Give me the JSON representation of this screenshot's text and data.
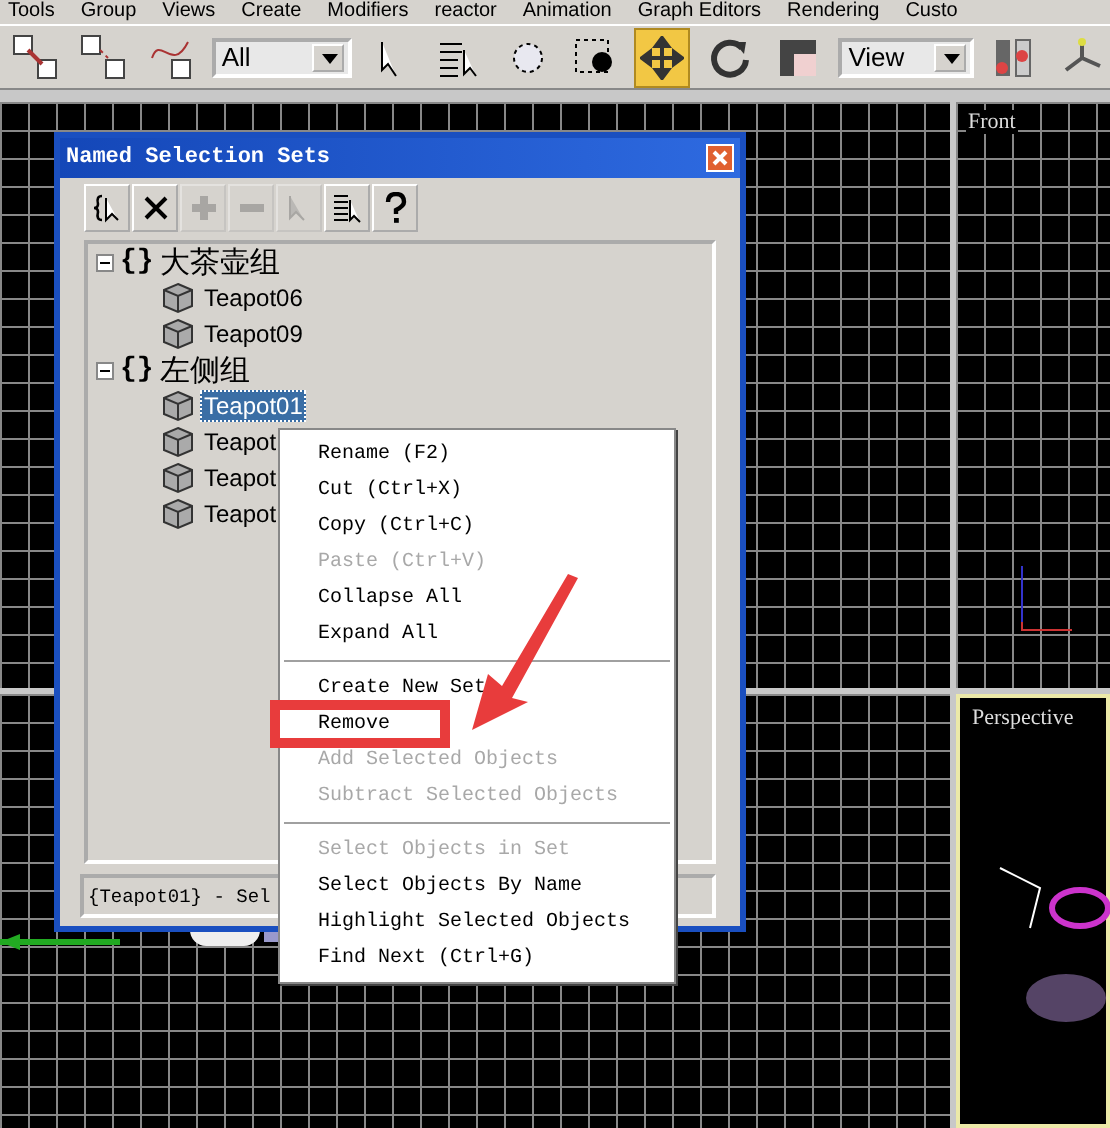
{
  "menu_bar": [
    "Tools",
    "Group",
    "Views",
    "Create",
    "Modifiers",
    "reactor",
    "Animation",
    "Graph Editors",
    "Rendering",
    "Custo"
  ],
  "toolbar": {
    "selection_filter": "All",
    "coordinate_system": "View",
    "move_active": true
  },
  "viewports": [
    {
      "selected": false
    },
    {
      "label": "Front",
      "selected": false
    },
    {
      "selected": false
    },
    {
      "label": "Perspective",
      "selected": true
    }
  ],
  "dialog": {
    "title": "Named Selection Sets",
    "tools": [
      {
        "disabled": false
      },
      {
        "disabled": false
      },
      {
        "disabled": true
      },
      {
        "disabled": true
      },
      {
        "disabled": true
      },
      {
        "disabled": false
      },
      {
        "disabled": false
      }
    ],
    "tree": [
      {
        "label": "{}",
        "name": "大茶壶组",
        "expanded": true,
        "children": [
          {
            "label": "Teapot06",
            "selected": false
          },
          {
            "label": "Teapot09",
            "selected": false
          }
        ]
      },
      {
        "label": "{}",
        "name": "左侧组",
        "expanded": true,
        "children": [
          {
            "label": "Teapot01",
            "selected": true
          },
          {
            "label": "Teapot",
            "selected": false
          },
          {
            "label": "Teapot",
            "selected": false
          },
          {
            "label": "Teapot",
            "selected": false
          }
        ]
      }
    ],
    "status": "{Teapot01} - Sel"
  },
  "context_menu": [
    {
      "kind": "item",
      "label": "Rename (F2)",
      "disabled": false
    },
    {
      "kind": "item",
      "label": "Cut (Ctrl+X)",
      "disabled": false
    },
    {
      "kind": "item",
      "label": "Copy (Ctrl+C)",
      "disabled": false
    },
    {
      "kind": "item",
      "label": "Paste (Ctrl+V)",
      "disabled": true
    },
    {
      "kind": "item",
      "label": "Collapse All",
      "disabled": false
    },
    {
      "kind": "item",
      "label": "Expand All",
      "disabled": false
    },
    {
      "kind": "separator"
    },
    {
      "kind": "item",
      "label": "Create New Set",
      "disabled": false
    },
    {
      "kind": "item",
      "label": "Remove",
      "disabled": false,
      "highlighted": true
    },
    {
      "kind": "item",
      "label": "Add Selected Objects",
      "disabled": true
    },
    {
      "kind": "item",
      "label": "Subtract Selected Objects",
      "disabled": true
    },
    {
      "kind": "separator"
    },
    {
      "kind": "item",
      "label": "Select Objects in Set",
      "disabled": true
    },
    {
      "kind": "item",
      "label": "Select Objects By Name",
      "disabled": false
    },
    {
      "kind": "item",
      "label": "Highlight Selected Objects",
      "disabled": false
    },
    {
      "kind": "item",
      "label": "Find Next (Ctrl+G)",
      "disabled": false
    }
  ]
}
